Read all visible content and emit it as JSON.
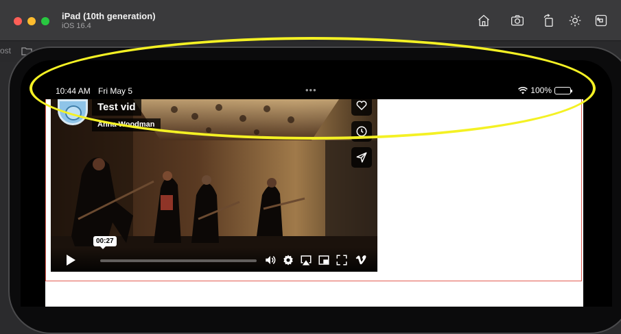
{
  "window": {
    "title": "iPad (10th generation)",
    "subtitle": "iOS 16.4",
    "toolbar": [
      "home-icon",
      "screenshot-icon",
      "rotate-icon",
      "appearance-icon",
      "keyboard-command-icon"
    ]
  },
  "host": {
    "partial_text": "ost"
  },
  "status_bar": {
    "time": "10:44 AM",
    "date": "Fri May 5",
    "multitask_dots": "•••",
    "battery_text": "100%"
  },
  "video": {
    "title": "Test vid",
    "owner": "Anna Woodman",
    "current_time": "00:27",
    "progress_fraction": 0.0,
    "side_actions": [
      "like-icon",
      "watch-later-icon",
      "share-icon"
    ],
    "controls": [
      "volume-icon",
      "settings-icon",
      "airplay-icon",
      "picture-in-picture-icon",
      "fullscreen-icon",
      "vimeo-logo-icon"
    ]
  },
  "colors": {
    "highlight": "#f4f124",
    "frame_border": "#e25a4f",
    "titlebar": "#3a3a3c"
  }
}
